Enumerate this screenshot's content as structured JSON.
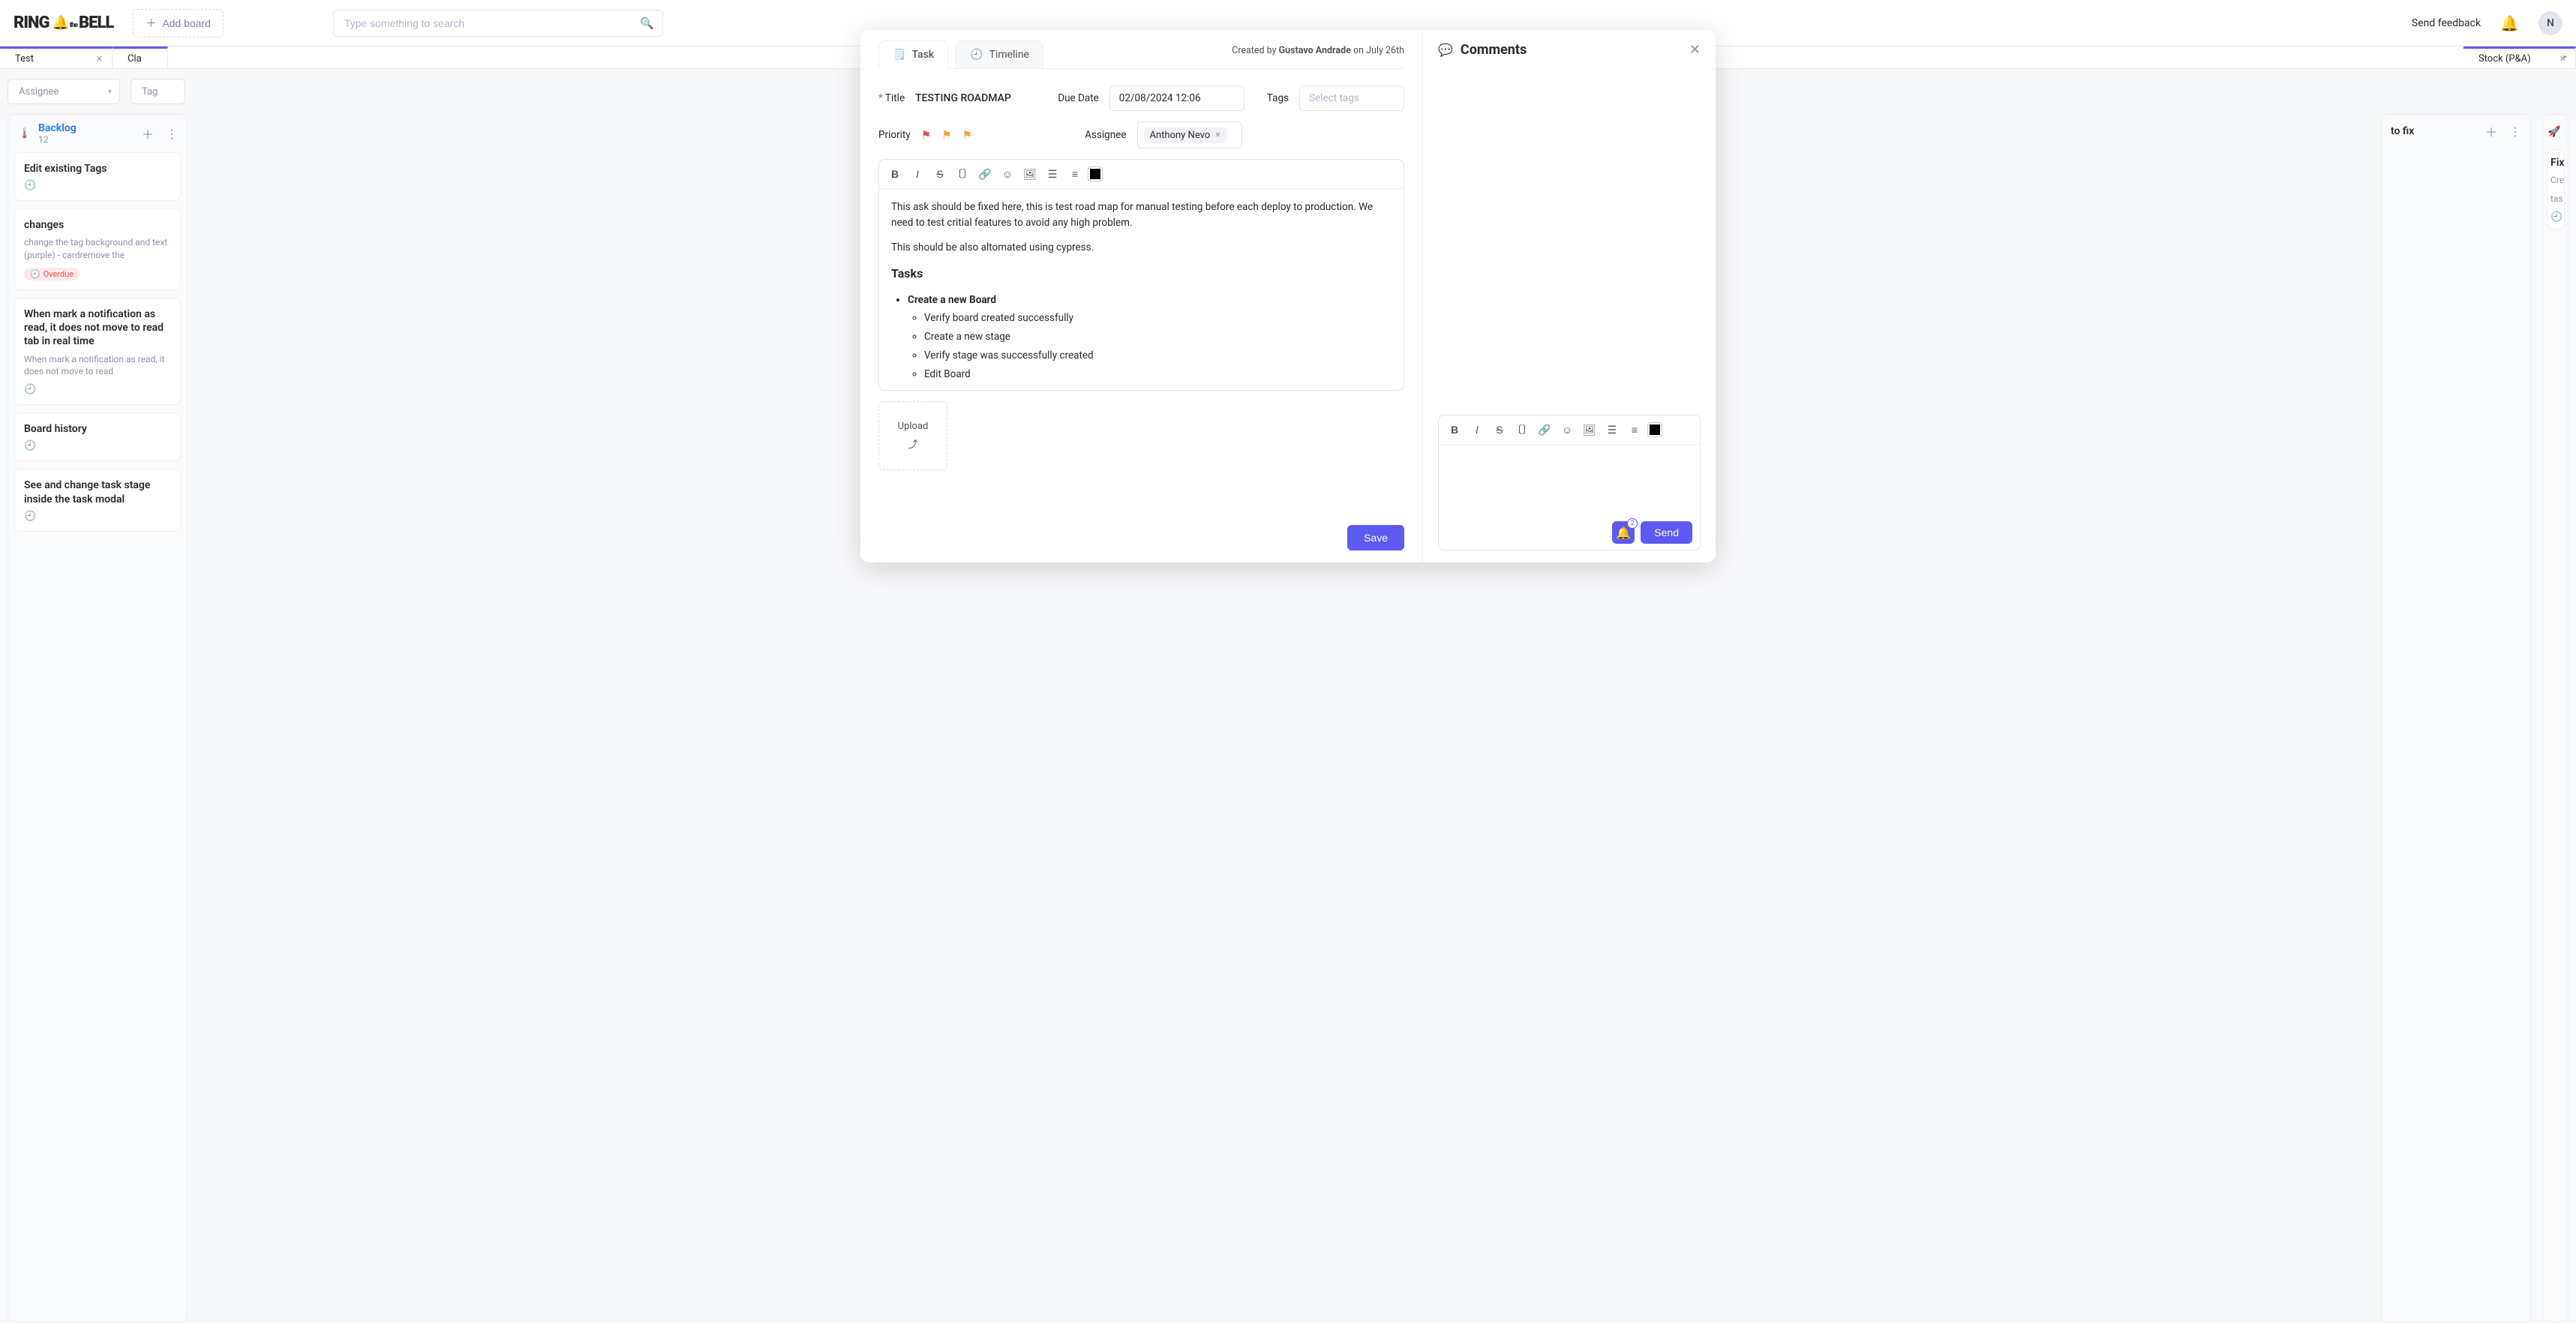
{
  "topbar": {
    "logo_left": "RING",
    "logo_right": "BELL",
    "logo_mid": "the",
    "add_board": "Add board",
    "search_placeholder": "Type something to search",
    "send_feedback": "Send feedback",
    "avatar_initial": "N"
  },
  "board_tabs": {
    "t0": {
      "label": "Test"
    },
    "t1": {
      "label": "Cla"
    },
    "t2": {
      "label": "Stock (P&A)"
    }
  },
  "filters": {
    "assignee": "Assignee",
    "tags_prefix": "Tag"
  },
  "columns": {
    "backlog": {
      "title": "Backlog",
      "count": "12"
    },
    "to_fix": {
      "title": "to fix"
    },
    "fix_peek": {
      "title": "Fix",
      "desc_peek": "Cre",
      "desc_peek2": "tas"
    }
  },
  "cards": {
    "c1": {
      "title": "Edit existing Tags"
    },
    "c2": {
      "title": "changes",
      "desc": "change the tag background and text (purple) - cardremove the",
      "overdue": "Overdue"
    },
    "c3": {
      "title": "When mark a notification as read, it does not move to read tab in real time",
      "desc": "When mark a notification as read, it does not move to read"
    },
    "c4": {
      "title": "Board history"
    },
    "c5": {
      "title": "See and change task stage inside the task modal"
    }
  },
  "modal": {
    "tabs": {
      "task": "Task",
      "timeline": "Timeline"
    },
    "created_prefix": "Created by ",
    "created_author": "Gustavo Andrade",
    "created_suffix": " on July 26th",
    "title_label": "Title",
    "title_value": "TESTING ROADMAP",
    "due_label": "Due Date",
    "due_value": "02/08/2024 12:06",
    "tags_label": "Tags",
    "tags_placeholder": "Select tags",
    "priority_label": "Priority",
    "assignee_label": "Assignee",
    "assignee_chip": "Anthony Nevo",
    "body_p1": "This ask should be fixed here, this is test road map for manual testing before each deploy to production. We need to test critial features to avoid any high problem.",
    "body_p2": "This should be also altomated using cypress.",
    "tasks_heading": "Tasks",
    "task_top": "Create a new Board",
    "sub1": "Verify board created successfully",
    "sub2": "Create a new stage",
    "sub3": "Verify stage was successfully created",
    "sub4": "Edit Board",
    "upload": "Upload",
    "save": "Save"
  },
  "side": {
    "comments": "Comments",
    "send": "Send",
    "badge": "2"
  }
}
